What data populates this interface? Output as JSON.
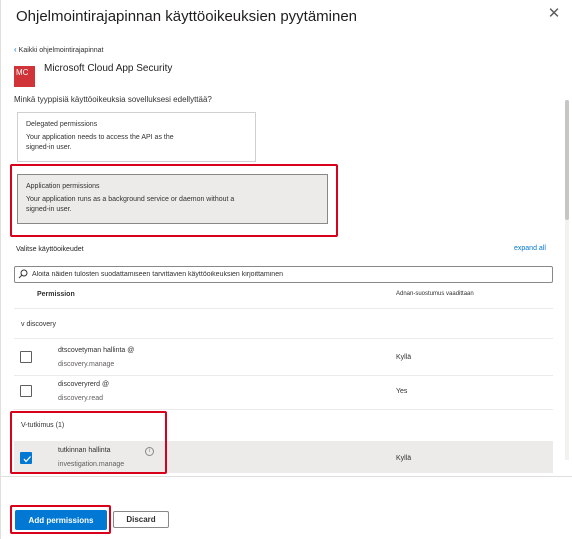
{
  "panel": {
    "title": "Ohjelmointirajapinnan käyttöoikeuksien pyytäminen",
    "close_glyph": "✕"
  },
  "back_link": "Kaikki ohjelmointirajapinnat",
  "api": {
    "badge": "MC",
    "name": "Microsoft Cloud App Security"
  },
  "question": "Minkä tyyppisiä käyttöoikeuksia sovelluksesi edellyttää?",
  "permission_types": [
    {
      "title": "Delegated permissions",
      "desc_1": "Your application needs to access the API as the",
      "desc_2": "signed-in user."
    },
    {
      "title": "Application permissions",
      "desc_1": "Your application runs as a background service or daemon without a",
      "desc_2": "signed-in user."
    }
  ],
  "select_label": "Valitse käyttöoikeudet",
  "expand_all": "expand all",
  "search": {
    "placeholder": "Aloita näiden tulosten suodattamiseen tarvittavien käyttöoikeuksien kirjoittaminen",
    "icon": "search-icon"
  },
  "table": {
    "col_permission": "Permission",
    "col_admin": "Adnan-suostumus vaadittaan"
  },
  "groups": [
    {
      "label": "v discovery",
      "rows": [
        {
          "name": "dtscovetyman hallinta @",
          "value": "discovery.manage",
          "admin": "Kyllä",
          "checked": false
        },
        {
          "name": "discoveryrerd @",
          "value": "discovery.read",
          "admin": "Yes",
          "checked": false
        }
      ]
    },
    {
      "label": "V-tutkimus (1)",
      "rows": [
        {
          "name": "tutkinnan hallinta",
          "value": "investigation.manage",
          "admin": "Kyllä",
          "checked": true
        }
      ]
    }
  ],
  "footer": {
    "add_label": "Add permissions",
    "discard_label": "Discard"
  },
  "colors": {
    "accent": "#0078d4",
    "highlight": "#d9001b",
    "badge": "#d13438"
  }
}
